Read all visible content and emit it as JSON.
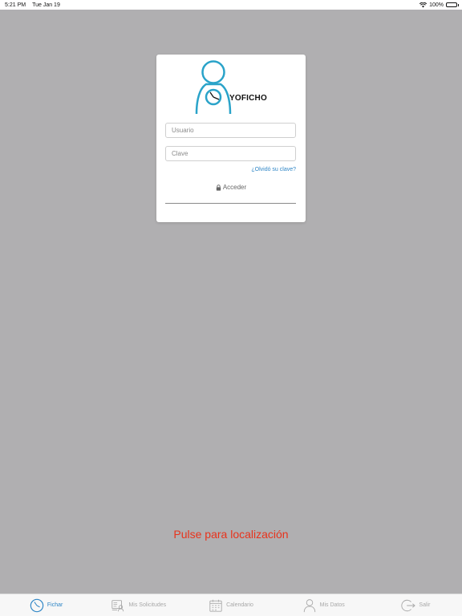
{
  "status_bar": {
    "time": "5:21 PM",
    "date": "Tue Jan 19",
    "battery": "100%"
  },
  "login": {
    "logo_text": "YOFICHO",
    "username_placeholder": "Usuario",
    "password_placeholder": "Clave",
    "forgot_label": "¿Olvidó su clave?",
    "submit_label": "Acceder"
  },
  "location_prompt": "Pulse para localización",
  "tabs": [
    {
      "label": "Fichar",
      "icon": "clock-icon",
      "active": true
    },
    {
      "label": "Mis Solicitudes",
      "icon": "requests-icon",
      "active": false
    },
    {
      "label": "Calendario",
      "icon": "calendar-icon",
      "active": false
    },
    {
      "label": "Mis Datos",
      "icon": "user-icon",
      "active": false
    },
    {
      "label": "Salir",
      "icon": "logout-icon",
      "active": false
    }
  ],
  "colors": {
    "accent": "#2f86c6",
    "logo": "#2aa3c9",
    "alert": "#e8331c",
    "background": "#b0afb1"
  }
}
